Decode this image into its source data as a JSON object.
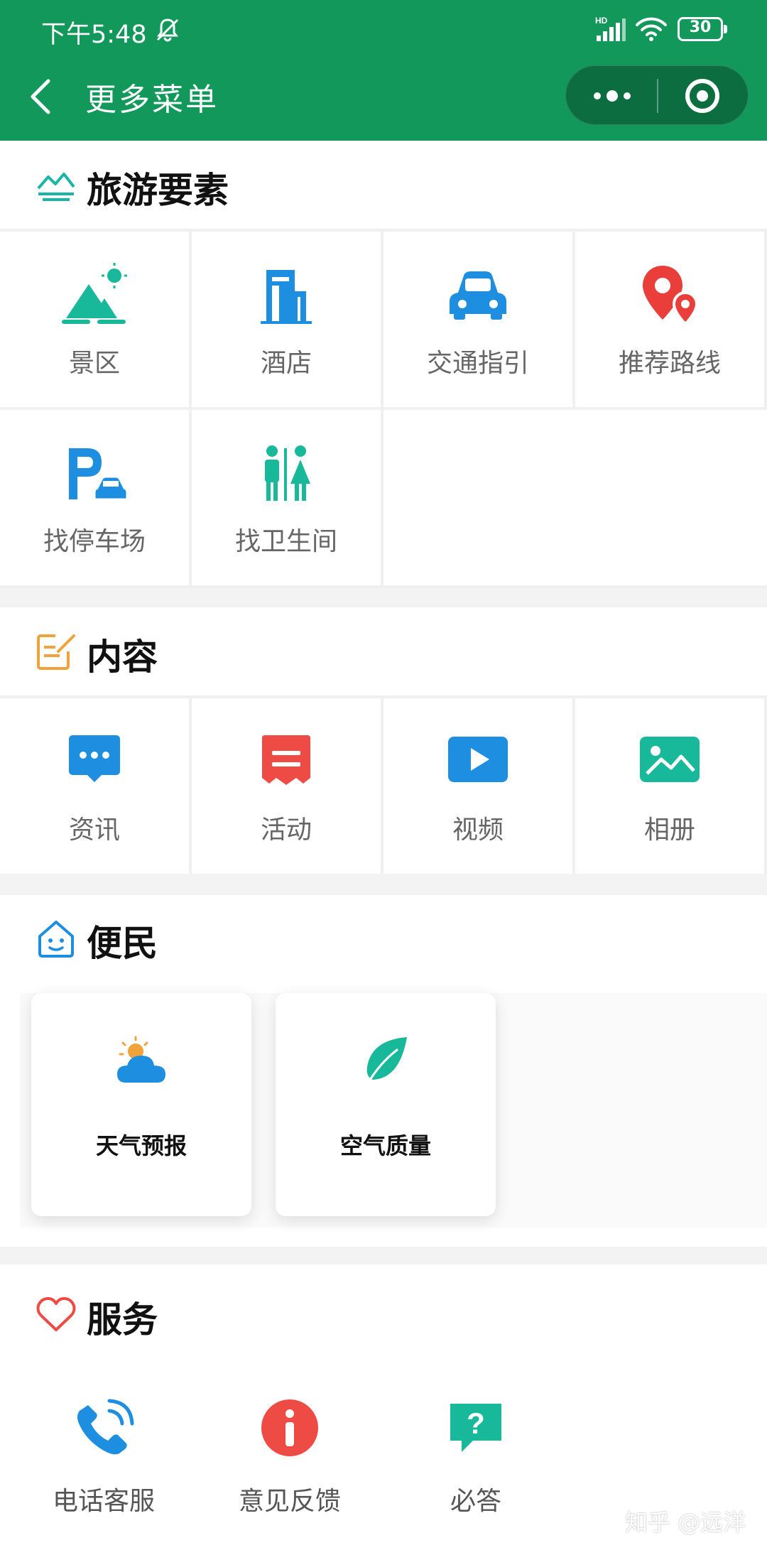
{
  "status_bar": {
    "time": "下午5:48",
    "battery": "30",
    "network": "HD"
  },
  "nav": {
    "title": "更多菜单"
  },
  "sections": {
    "tourism": {
      "title": "旅游要素",
      "items": [
        {
          "label": "景区",
          "icon": "mountain-sun-icon"
        },
        {
          "label": "酒店",
          "icon": "hotel-building-icon"
        },
        {
          "label": "交通指引",
          "icon": "car-icon"
        },
        {
          "label": "推荐路线",
          "icon": "route-pin-icon"
        },
        {
          "label": "找停车场",
          "icon": "parking-icon"
        },
        {
          "label": "找卫生间",
          "icon": "restroom-icon"
        }
      ]
    },
    "content": {
      "title": "内容",
      "items": [
        {
          "label": "资讯",
          "icon": "chat-bubble-icon"
        },
        {
          "label": "活动",
          "icon": "ticket-icon"
        },
        {
          "label": "视频",
          "icon": "play-icon"
        },
        {
          "label": "相册",
          "icon": "photo-icon"
        }
      ]
    },
    "convenience": {
      "title": "便民",
      "items": [
        {
          "label": "天气预报",
          "icon": "weather-cloud-sun-icon"
        },
        {
          "label": "空气质量",
          "icon": "leaf-icon"
        }
      ]
    },
    "service": {
      "title": "服务",
      "items": [
        {
          "label": "电话客服",
          "icon": "phone-icon"
        },
        {
          "label": "意见反馈",
          "icon": "info-icon"
        },
        {
          "label": "必答",
          "icon": "question-bubble-icon"
        }
      ]
    }
  },
  "watermark": "知乎 @远洋",
  "colors": {
    "header_green": "#11985a",
    "teal": "#18b89a",
    "blue": "#1e8ee0",
    "red": "#ee4b45",
    "orange": "#f0a33a"
  }
}
